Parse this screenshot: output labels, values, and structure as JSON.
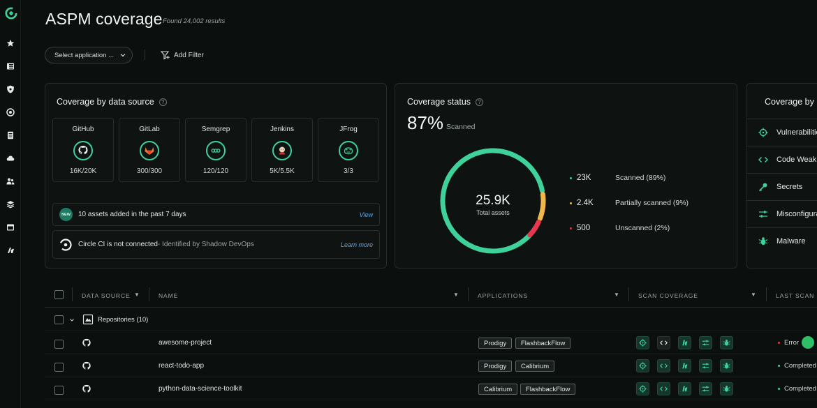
{
  "header": {
    "title": "ASPM coverage",
    "found": "Found 24,002 results",
    "select_application": "Select application ...",
    "add_filter": "Add Filter"
  },
  "sidebar": {
    "items": [
      "star-icon",
      "layout-icon",
      "shield-icon",
      "target-icon",
      "document-icon",
      "cloud-icon",
      "people-icon",
      "layers-icon",
      "window-icon",
      "scan-icon"
    ]
  },
  "data_source_card": {
    "title": "Coverage by data source",
    "sources": [
      {
        "name": "GitHub",
        "value": "16K/20K",
        "icon": "github-icon"
      },
      {
        "name": "GitLab",
        "value": "300/300",
        "icon": "gitlab-icon"
      },
      {
        "name": "Semgrep",
        "value": "120/120",
        "icon": "semgrep-icon"
      },
      {
        "name": "Jenkins",
        "value": "5K/5.5K",
        "icon": "jenkins-icon"
      },
      {
        "name": "JFrog",
        "value": "3/3",
        "icon": "jfrog-icon"
      }
    ],
    "new_badge": "NEW",
    "notice_assets": "10 assets added in the past 7 days",
    "notice_assets_link": "View",
    "notice_ci_main": "Circle CI is not connected",
    "notice_ci_sub": " - Identified by Shadow DevOps",
    "notice_ci_link": "Learn more"
  },
  "status_card": {
    "title": "Coverage status",
    "percent": "87%",
    "percent_label": "Scanned",
    "total": "25.9K",
    "total_label": "Total assets",
    "legend": [
      {
        "value": "23K",
        "label": "Scanned (89%)",
        "color": "#3ed19a"
      },
      {
        "value": "2.4K",
        "label": "Partially scanned (9%)",
        "color": "#f0b84a"
      },
      {
        "value": "500",
        "label": "Unscanned (2%)",
        "color": "#e8364f"
      }
    ],
    "chart_data": {
      "type": "pie",
      "categories": [
        "Scanned",
        "Partially scanned",
        "Unscanned"
      ],
      "values": [
        89,
        9,
        2
      ]
    }
  },
  "type_card": {
    "title": "Coverage by",
    "rows": [
      {
        "label": "Vulnerabilities",
        "icon": "crosshair-icon"
      },
      {
        "label": "Code Weaknesses",
        "icon": "code-icon"
      },
      {
        "label": "Secrets",
        "icon": "key-icon"
      },
      {
        "label": "Misconfigurations",
        "icon": "sliders-icon"
      },
      {
        "label": "Malware",
        "icon": "bug-icon"
      }
    ]
  },
  "table": {
    "headers": {
      "data_source": "Data source",
      "name": "Name",
      "applications": "Applications",
      "scan_coverage": "Scan coverage",
      "last_scan": "Last scan s"
    },
    "group_label": "Repositories (10)",
    "rows": [
      {
        "name": "awesome-project",
        "apps": [
          "Prodigy",
          "FlashbackFlow"
        ],
        "status": "Error",
        "status_color": "#e8364f"
      },
      {
        "name": "react-todo-app",
        "apps": [
          "Prodigy",
          "Calibrium"
        ],
        "status": "Completed",
        "status_color": "#3ed19a"
      },
      {
        "name": "python-data-science-toolkit",
        "apps": [
          "Calibrium",
          "FlashbackFlow"
        ],
        "status": "Completed",
        "status_color": "#3ed19a"
      }
    ]
  }
}
